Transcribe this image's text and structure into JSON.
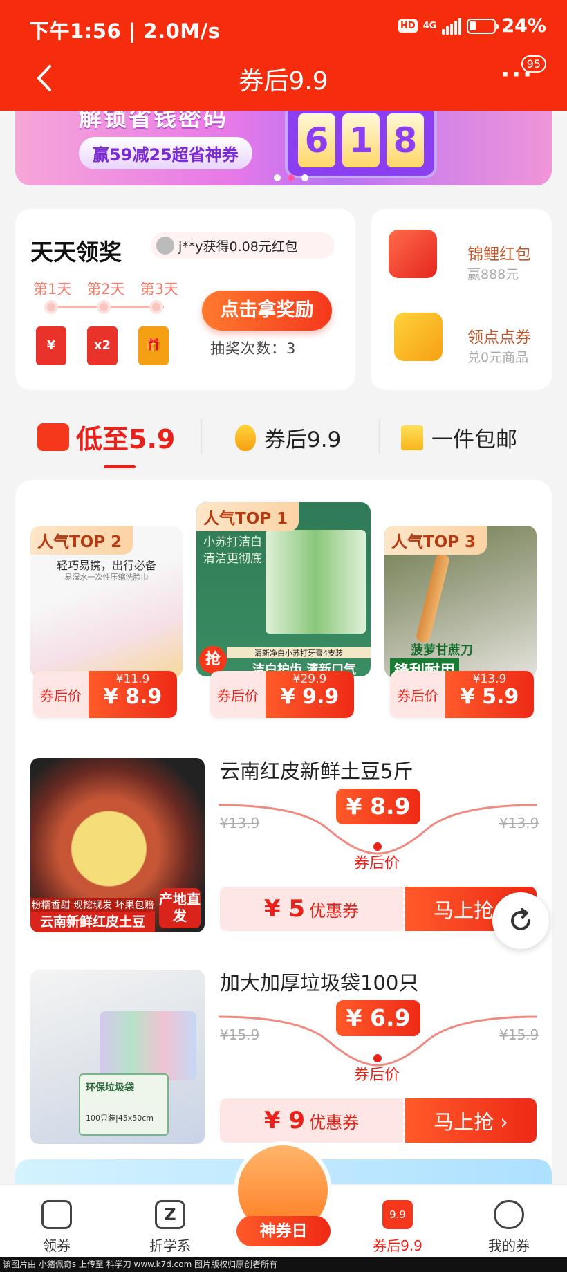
{
  "status": {
    "time": "下午1:56 | 2.0M/s",
    "network": "4G",
    "hd": "HD",
    "battery": "24%"
  },
  "header": {
    "title": "券后9.9",
    "more_badge": "95"
  },
  "banner": {
    "headline": "解锁省钱密码",
    "pill": "赢59减25超省神券",
    "slot_digits": [
      "6",
      "1",
      "8"
    ]
  },
  "daily": {
    "title": "天天领奖",
    "ticker": "j**y获得0.08元红包",
    "days": [
      "第1天",
      "第2天",
      "第3天"
    ],
    "double_label": "x2",
    "claim_button": "点击拿奖励",
    "draw_count": "抽奖次数：3"
  },
  "side": [
    {
      "title": "锦鲤红包",
      "sub": "赢888元"
    },
    {
      "title": "领点点券",
      "sub": "兑0元商品"
    }
  ],
  "tabs": [
    {
      "label": "低至5.9",
      "active": true
    },
    {
      "label": "券后9.9",
      "active": false
    },
    {
      "label": "一件包邮",
      "active": false
    }
  ],
  "top_products": [
    {
      "tag": "人气TOP 2",
      "caption": "轻巧易携，出行必备",
      "caption2": "易湿水一次性压缩洗脸巾",
      "label": "券后价",
      "old": "¥11.9",
      "price": "¥ 8.9"
    },
    {
      "tag": "人气TOP 1",
      "caption": "小苏打洁白 清洁更彻底",
      "caption2": "清新净白小苏打牙膏4支装",
      "banner": "洁白护齿 清新口气",
      "grab": "抢",
      "label": "券后价",
      "old": "¥29.9",
      "price": "¥ 9.9"
    },
    {
      "tag": "人气TOP 3",
      "caption": "菠萝甘蔗刀",
      "caption2": "锋利耐用",
      "label": "券后价",
      "old": "¥13.9",
      "price": "¥ 5.9"
    }
  ],
  "items": [
    {
      "title": "云南红皮新鲜土豆5斤",
      "old_left": "¥13.9",
      "old_right": "¥13.9",
      "price": "¥ 8.9",
      "after": "券后价",
      "coupon_amount": "¥ 5",
      "coupon_label": "优惠券",
      "buy": "马上抢 ›",
      "img_tags": [
        "粉糯香甜",
        "现挖现发",
        "坏果包赔"
      ],
      "img_title": "云南新鲜红皮土豆",
      "img_badge": "产地直发"
    },
    {
      "title": "加大加厚垃圾袋100只",
      "old_left": "¥15.9",
      "old_right": "¥15.9",
      "price": "¥ 6.9",
      "after": "券后价",
      "coupon_amount": "¥ 9",
      "coupon_label": "优惠券",
      "buy": "马上抢 ›",
      "img_title": "环保垃圾袋",
      "img_sub": "100只装|45x50cm"
    }
  ],
  "nav": [
    {
      "label": "领券"
    },
    {
      "label": "折学系"
    },
    {
      "label": "神券日"
    },
    {
      "label": "券后9.9",
      "icon_text": "9.9"
    },
    {
      "label": "我的券"
    }
  ],
  "footer": "该图片由 小猪佩奇s 上传至 科学刀 www.k7d.com 图片版权归原创者所有",
  "colors": {
    "brand_red": "#f52d0c",
    "accent": "#e8221a",
    "pale": "#fde6e4"
  }
}
